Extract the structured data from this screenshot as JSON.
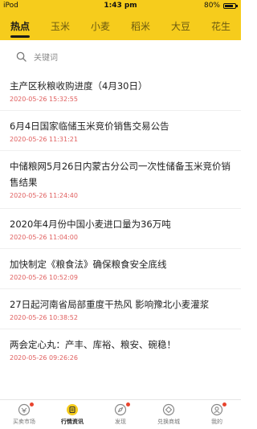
{
  "status": {
    "carrier": "iPod",
    "time": "1:43 pm",
    "battery": "80%",
    "battery_level": 0.8
  },
  "tabs": [
    {
      "label": "热点",
      "active": true
    },
    {
      "label": "玉米",
      "active": false
    },
    {
      "label": "小麦",
      "active": false
    },
    {
      "label": "稻米",
      "active": false
    },
    {
      "label": "大豆",
      "active": false
    },
    {
      "label": "花生",
      "active": false
    }
  ],
  "search": {
    "placeholder": "关键词",
    "icon": "search-icon"
  },
  "news": [
    {
      "title": "主产区秋粮收购进度（4月30日）",
      "date": "2020-05-26 15:32:55"
    },
    {
      "title": "6月4日国家临储玉米竞价销售交易公告",
      "date": "2020-05-26 11:31:21"
    },
    {
      "title": "中储粮网5月26日内蒙古分公司一次性储备玉米竞价销售结果",
      "date": "2020-05-26 11:24:40"
    },
    {
      "title": "2020年4月份中国小麦进口量为36万吨",
      "date": "2020-05-26 11:04:00"
    },
    {
      "title": "加快制定《粮食法》确保粮食安全底线",
      "date": "2020-05-26 10:52:09"
    },
    {
      "title": "27日起河南省局部重度干热风 影响豫北小麦灌浆",
      "date": "2020-05-26 10:38:52"
    },
    {
      "title": "两会定心丸：产丰、库裕、粮安、碗稳！",
      "date": "2020-05-26 09:26:26"
    }
  ],
  "bottom_nav": [
    {
      "label": "买卖市场",
      "icon": "market-icon",
      "badge": true,
      "active": false
    },
    {
      "label": "行情资讯",
      "icon": "news-icon",
      "badge": false,
      "active": true
    },
    {
      "label": "发现",
      "icon": "discover-icon",
      "badge": true,
      "active": false
    },
    {
      "label": "兑换商城",
      "icon": "shop-icon",
      "badge": false,
      "active": false
    },
    {
      "label": "我的",
      "icon": "profile-icon",
      "badge": true,
      "active": false
    }
  ],
  "colors": {
    "accent": "#f6cc1c",
    "date": "#e06060",
    "badge": "#e8442e"
  }
}
